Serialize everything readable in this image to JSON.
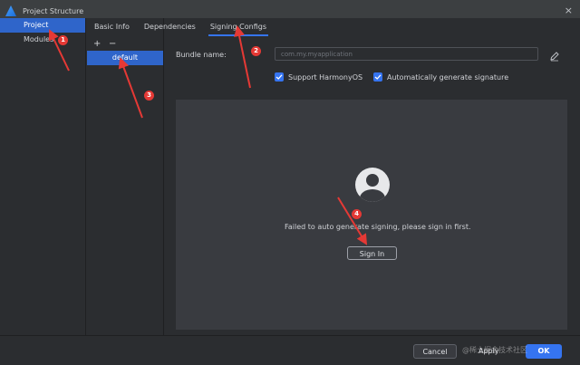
{
  "window": {
    "title": "Project Structure",
    "close_label": "×"
  },
  "left_nav": {
    "items": [
      {
        "label": "Project"
      },
      {
        "label": "Modules"
      }
    ]
  },
  "tabs": [
    {
      "label": "Basic Info"
    },
    {
      "label": "Dependencies"
    },
    {
      "label": "Signing Configs"
    }
  ],
  "middle": {
    "add_label": "+",
    "remove_label": "−",
    "items": [
      {
        "label": "default"
      }
    ]
  },
  "form": {
    "bundle_label": "Bundle name:",
    "bundle_value": "com.my.myapplication",
    "support_label": "Support HarmonyOS",
    "auto_label": "Automatically generate signature"
  },
  "signin": {
    "message": "Failed to auto generate signing, please sign in first.",
    "button_label": "Sign In"
  },
  "footer": {
    "cancel_label": "Cancel",
    "apply_label": "Apply",
    "ok_label": "OK"
  },
  "watermark": {
    "text": "@稀土掘金技术社区"
  },
  "annotations": [
    {
      "label": "1"
    },
    {
      "label": "2"
    },
    {
      "label": "3"
    },
    {
      "label": "4"
    }
  ],
  "colors": {
    "accent": "#3574f0",
    "annotation": "#e53935",
    "selection": "#2f65ca"
  }
}
